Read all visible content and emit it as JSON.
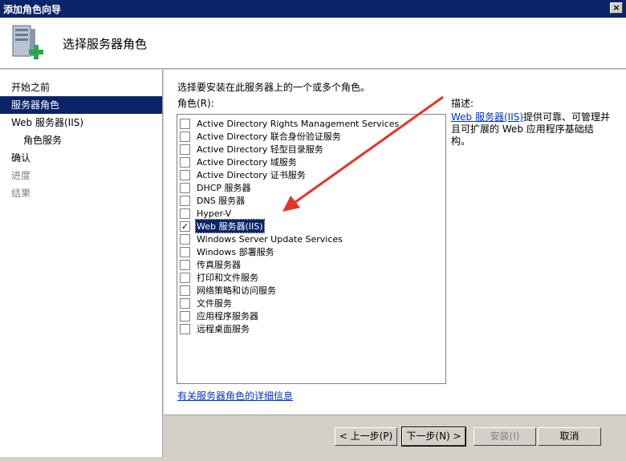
{
  "window": {
    "title": "添加角色向导",
    "close_glyph": "×"
  },
  "header": {
    "title": "选择服务器角色",
    "icon": "server-add-icon"
  },
  "sidebar": {
    "items": [
      {
        "label": "开始之前"
      },
      {
        "label": "服务器角色"
      },
      {
        "label": "Web 服务器(IIS)"
      },
      {
        "label": "角色服务"
      },
      {
        "label": "确认"
      },
      {
        "label": "进度"
      },
      {
        "label": "结果"
      }
    ]
  },
  "main": {
    "instruction": "选择要安装在此服务器上的一个或多个角色。",
    "roles_label": "角色(R):",
    "roles": [
      {
        "label": "Active Directory Rights Management Services",
        "checked": false
      },
      {
        "label": "Active Directory 联合身份验证服务",
        "checked": false
      },
      {
        "label": "Active Directory 轻型目录服务",
        "checked": false
      },
      {
        "label": "Active Directory 域服务",
        "checked": false
      },
      {
        "label": "Active Directory 证书服务",
        "checked": false
      },
      {
        "label": "DHCP 服务器",
        "checked": false
      },
      {
        "label": "DNS 服务器",
        "checked": false
      },
      {
        "label": "Hyper-V",
        "checked": false
      },
      {
        "label": "Web 服务器(IIS)",
        "checked": true
      },
      {
        "label": "Windows Server Update Services",
        "checked": false
      },
      {
        "label": "Windows 部署服务",
        "checked": false
      },
      {
        "label": "传真服务器",
        "checked": false
      },
      {
        "label": "打印和文件服务",
        "checked": false
      },
      {
        "label": "网络策略和访问服务",
        "checked": false
      },
      {
        "label": "文件服务",
        "checked": false
      },
      {
        "label": "应用程序服务器",
        "checked": false
      },
      {
        "label": "远程桌面服务",
        "checked": false
      }
    ],
    "more_info_link": "有关服务器角色的详细信息",
    "description": {
      "title": "描述:",
      "link": "Web 服务器(IIS)",
      "text": "提供可靠、可管理并且可扩展的 Web 应用程序基础结构。"
    }
  },
  "footer": {
    "back": "< 上一步(P)",
    "next": "下一步(N) >",
    "install": "安装(I)",
    "cancel": "取消"
  },
  "colors": {
    "selection": "#0a246a",
    "arrow": "#e8332a",
    "link": "#0033cc"
  }
}
